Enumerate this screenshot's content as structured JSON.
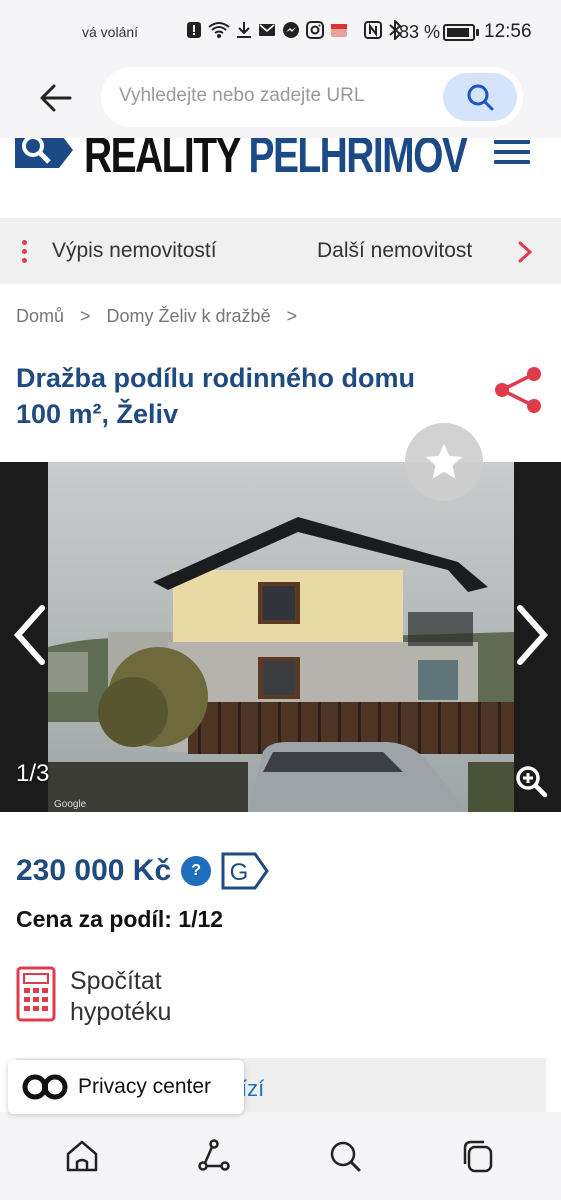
{
  "status_bar": {
    "carrier": "vá volání",
    "battery": "83 %",
    "time": "12:56"
  },
  "browser": {
    "url_placeholder": "Vyhledejte nebo zadejte URL"
  },
  "site": {
    "logo_part1": "REALITY",
    "logo_part2": "PELHŘIMOV"
  },
  "listing_nav": {
    "listing_link": "Výpis nemovitostí",
    "next_link": "Další nemovitost"
  },
  "breadcrumb": {
    "items": [
      "Domů",
      "Domy Želiv k dražbě"
    ],
    "separator": ">"
  },
  "title": "Dražba podílu rodinného domu 100 m², Želiv",
  "gallery": {
    "counter": "1/3",
    "watermark": "Google"
  },
  "price": {
    "amount": "230 000 Kč",
    "help": "?",
    "energy_class": "G",
    "share": "Cena za podíl: 1/12"
  },
  "mortgage": {
    "line1": "Spočítat",
    "line2": "hypotéku"
  },
  "partial_text": "ízí",
  "privacy": {
    "label": "Privacy center"
  },
  "colors": {
    "brand_blue": "#1f4b80",
    "accent_red": "#e03b4b",
    "link_blue": "#1f6fbf"
  }
}
